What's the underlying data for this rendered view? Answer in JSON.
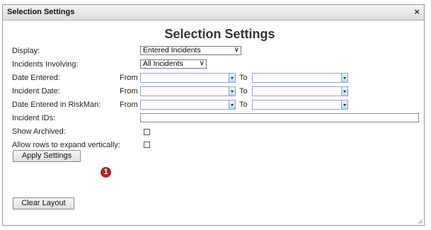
{
  "window": {
    "title": "Selection Settings",
    "close_glyph": "×"
  },
  "heading": "Selection Settings",
  "rows": {
    "display": {
      "label": "Display:",
      "value": "Entered Incidents"
    },
    "involving": {
      "label": "Incidents Involving:",
      "value": "All Incidents"
    },
    "date_entered": {
      "label": "Date Entered:",
      "from": "From",
      "to": "To"
    },
    "incident_date": {
      "label": "Incident Date:",
      "from": "From",
      "to": "To"
    },
    "date_entered_riskman": {
      "label": "Date Entered in RiskMan:",
      "from": "From",
      "to": "To"
    },
    "incident_ids": {
      "label": "Incident IDs:"
    },
    "show_archived": {
      "label": "Show Archived:"
    },
    "expand_rows": {
      "label": "Allow rows to expand vertically:"
    }
  },
  "buttons": {
    "apply": "Apply Settings",
    "clear": "Clear Layout"
  },
  "marker": "1",
  "colors": {
    "marker": "#a8292b",
    "date_border": "#8ea6c6"
  }
}
